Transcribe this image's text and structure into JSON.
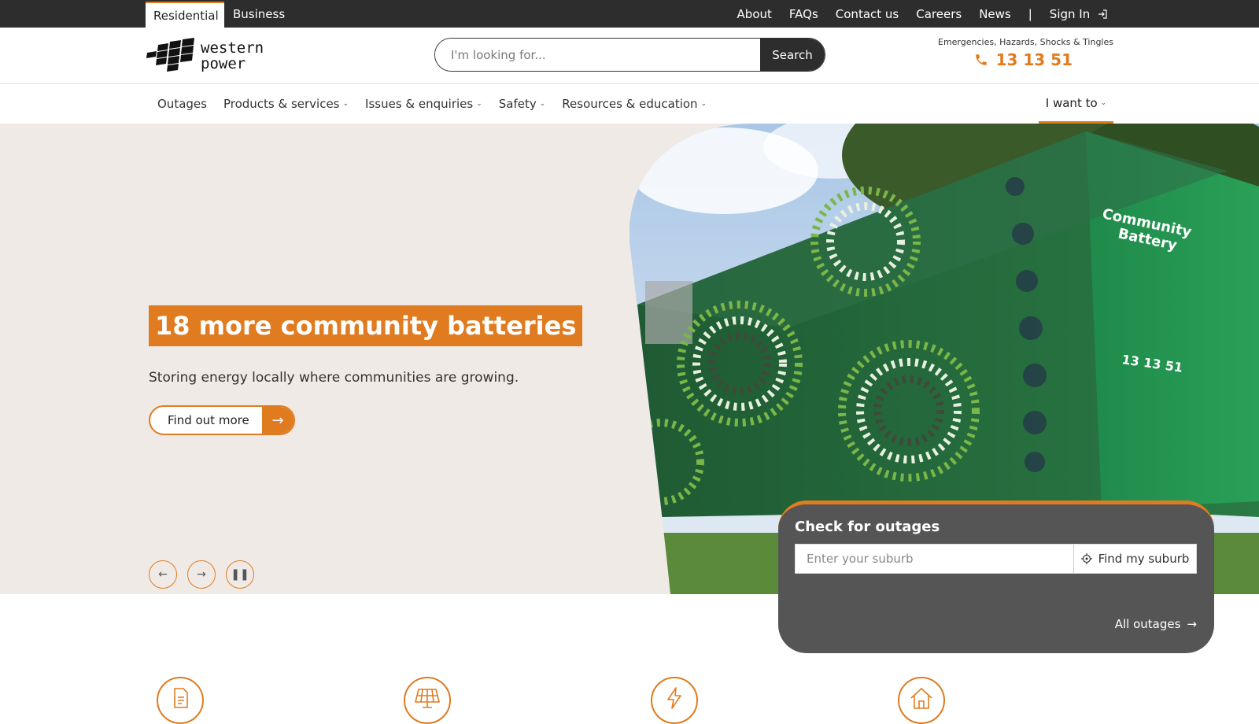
{
  "topbar": {
    "segments": {
      "residential": "Residential",
      "business": "Business"
    },
    "links": {
      "about": "About",
      "faqs": "FAQs",
      "contact": "Contact us",
      "careers": "Careers",
      "news": "News",
      "separator": "|",
      "signin": "Sign In"
    }
  },
  "header": {
    "logo_text": [
      "western",
      "power"
    ],
    "search": {
      "placeholder": "I'm looking for...",
      "button": "Search"
    },
    "emergency": {
      "label": "Emergencies, Hazards, Shocks & Tingles",
      "phone": "13 13 51"
    }
  },
  "nav": {
    "items": [
      {
        "label": "Outages",
        "dropdown": false
      },
      {
        "label": "Products & services",
        "dropdown": true
      },
      {
        "label": "Issues & enquiries",
        "dropdown": true
      },
      {
        "label": "Safety",
        "dropdown": true
      },
      {
        "label": "Resources & education",
        "dropdown": true
      }
    ],
    "i_want_to": "I want to"
  },
  "hero": {
    "title": "18 more community batteries",
    "subtitle": "Storing energy locally where communities are growing.",
    "cta": "Find out more",
    "battery_labels": {
      "line1": "Community",
      "line2": "Battery",
      "phone": "13 13 51"
    }
  },
  "outage": {
    "title": "Check for outages",
    "placeholder": "Enter your suburb",
    "find_button": "Find my suburb",
    "all_link": "All outages"
  },
  "colors": {
    "accent": "#e07b20",
    "dark": "#2d2d2d",
    "hero_bg": "#f0eae7",
    "panel": "#555555"
  }
}
